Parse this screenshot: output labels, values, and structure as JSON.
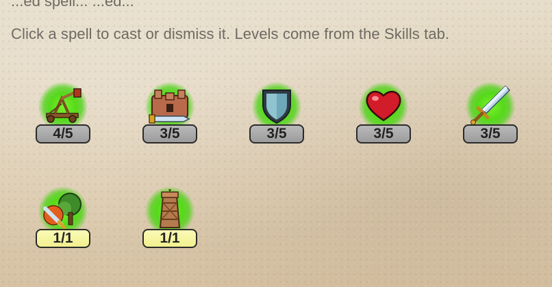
{
  "header": {
    "clipped_text": "...ed spell... ...ed...",
    "instructions": "Click a spell to cast or dismiss it. Levels come from the Skills tab."
  },
  "spells": [
    {
      "icon": "catapult-icon",
      "level": "4/5",
      "badge_style": "grey"
    },
    {
      "icon": "fortress-sword-icon",
      "level": "3/5",
      "badge_style": "grey"
    },
    {
      "icon": "shield-icon",
      "level": "3/5",
      "badge_style": "grey"
    },
    {
      "icon": "heart-icon",
      "level": "3/5",
      "badge_style": "grey"
    },
    {
      "icon": "sword-icon",
      "level": "3/5",
      "badge_style": "grey"
    },
    {
      "icon": "forest-sword-icon",
      "level": "1/1",
      "badge_style": "yellow"
    },
    {
      "icon": "watchtower-icon",
      "level": "1/1",
      "badge_style": "yellow"
    }
  ],
  "colors": {
    "glow": "#55d91a",
    "badge_grey": "#a8a8a8",
    "badge_yellow": "#f6f4a2",
    "text": "#6e6a63"
  }
}
